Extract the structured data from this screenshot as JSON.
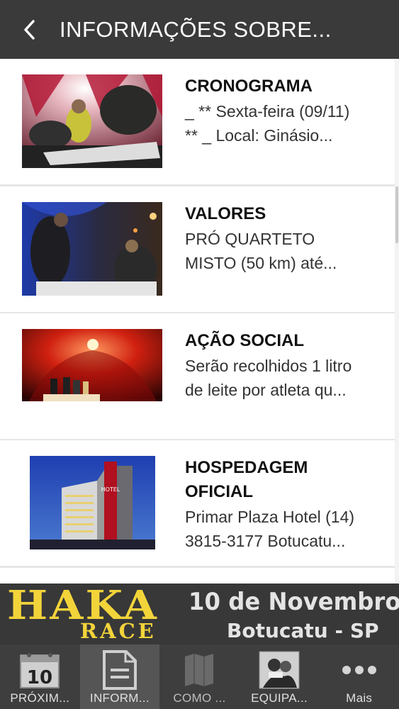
{
  "header": {
    "title": "INFORMAÇÕES SOBRE..."
  },
  "items": [
    {
      "title": "CRONOGRAMA",
      "desc1": "_ ** Sexta-feira (09/11)",
      "desc2": "** _ Local: Ginásio..."
    },
    {
      "title": "VALORES",
      "desc1": "PRÓ QUARTETO",
      "desc2": "MISTO (50 km) até..."
    },
    {
      "title": "AÇÃO SOCIAL",
      "desc1": "Serão recolhidos 1 litro",
      "desc2": "de leite por atleta qu..."
    },
    {
      "title1": "HOSPEDAGEM",
      "title2": "OFICIAL",
      "desc1": "Primar Plaza Hotel (14)",
      "desc2": "3815-3177 Botucatu...",
      "hotel_sign": "HOTEL"
    }
  ],
  "banner": {
    "brand1": "HAKA",
    "brand2": "RACE",
    "date": "10 de Novembro",
    "city": "Botucatu - SP"
  },
  "tabs": [
    {
      "label": "PRÓXIM...",
      "icon": "calendar-icon",
      "icon_text": "10"
    },
    {
      "label": "INFORM...",
      "icon": "document-icon"
    },
    {
      "label": "COMO ...",
      "icon": "map-icon"
    },
    {
      "label": "EQUIPA...",
      "icon": "team-photo-icon"
    },
    {
      "label": "Mais",
      "icon": "more-dots-icon"
    }
  ],
  "colors": {
    "header_bg": "#3a3a3a",
    "tabbar_bg": "#3e3e3e",
    "brand_yellow": "#f2d43a"
  }
}
